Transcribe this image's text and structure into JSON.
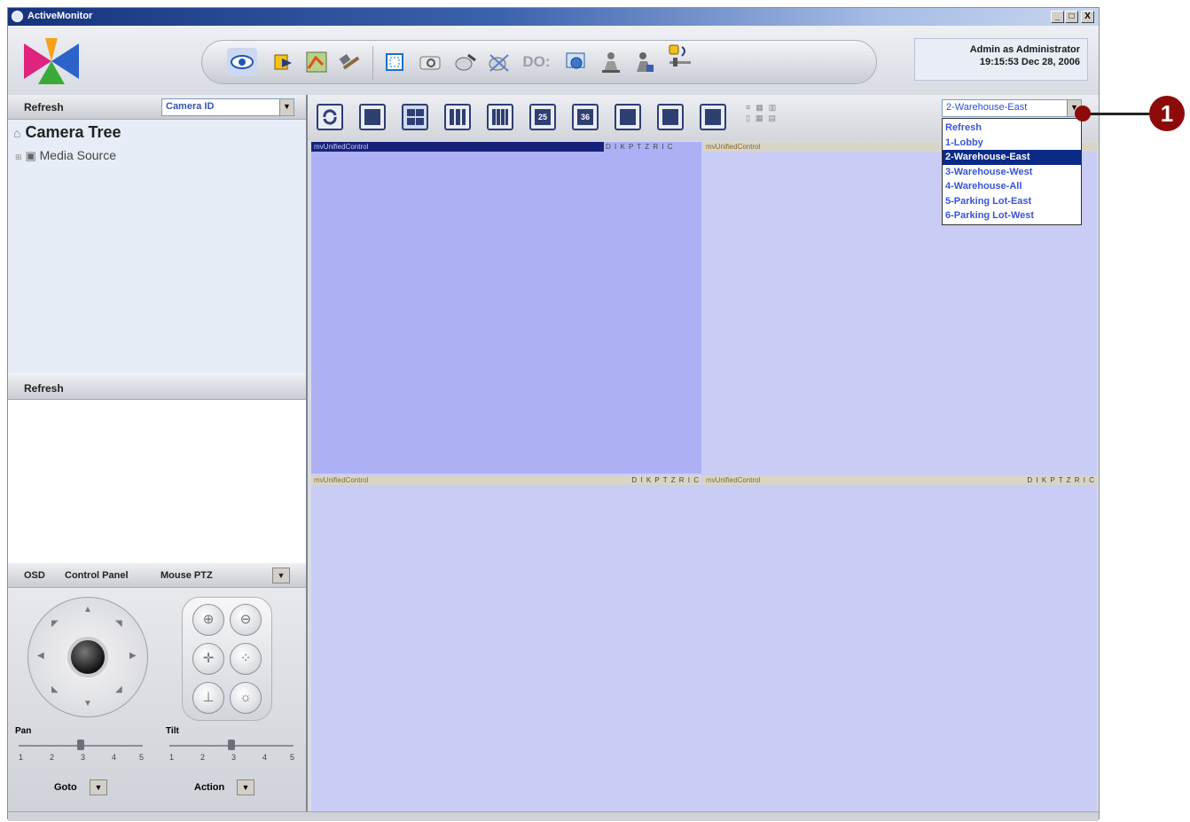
{
  "window": {
    "title": "ActiveMonitor",
    "controls": {
      "minimize": "_",
      "maximize": "□",
      "close": "X"
    }
  },
  "header": {
    "user": "Admin as Administrator",
    "datetime": "19:15:53 Dec 28, 2006",
    "toolbar_icons": [
      "live-view-icon",
      "playback-icon",
      "map-icon",
      "tools-icon",
      "fullscreen-icon",
      "snapshot-icon",
      "record-icon",
      "stop-record-icon",
      "digital-output-icon",
      "settings-icon",
      "ptz-operator-icon",
      "ptz-user-icon",
      "audio-icon"
    ],
    "do_label": "DO:"
  },
  "left_panel": {
    "top_bar": {
      "refresh": "Refresh",
      "camera_select": "Camera ID"
    },
    "tree": {
      "root": "Camera Tree",
      "child": "Media Source"
    },
    "second_bar": {
      "refresh": "Refresh"
    },
    "ptz_tabs": [
      "OSD",
      "Control Panel",
      "Mouse PTZ"
    ],
    "pan_label": "Pan",
    "tilt_label": "Tilt",
    "scale": [
      "1",
      "2",
      "3",
      "4",
      "5"
    ],
    "goto_label": "Goto",
    "action_label": "Action",
    "pan_value": 3,
    "tilt_value": 3
  },
  "video": {
    "layout_buttons": [
      "cycle",
      "1x1",
      "2x2",
      "3x3",
      "4x4",
      "25",
      "36",
      "1+5",
      "1+7",
      "1+12"
    ],
    "viewport_label": "mvUnifiedControl",
    "viewport_controls": "D I K P T Z R I C",
    "viewports": [
      {
        "label": "mvUnifiedControl",
        "selected": true
      },
      {
        "label": "mvUnifiedControl",
        "selected": false
      },
      {
        "label": "mvUnifiedControl",
        "selected": false
      },
      {
        "label": "mvUnifiedControl",
        "selected": false
      }
    ]
  },
  "camera_dropdown": {
    "selected": "2-Warehouse-East",
    "options": [
      "Refresh",
      "1-Lobby",
      "2-Warehouse-East",
      "3-Warehouse-West",
      "4-Warehouse-All",
      "5-Parking Lot-East",
      "6-Parking Lot-West"
    ],
    "selected_index": 2
  },
  "callout": {
    "number": "1"
  },
  "colors": {
    "accent": "#0b2a86",
    "callout": "#8d0a0a",
    "viewport": "#c9cdf5",
    "viewport_selected": "#aeb0f5"
  }
}
